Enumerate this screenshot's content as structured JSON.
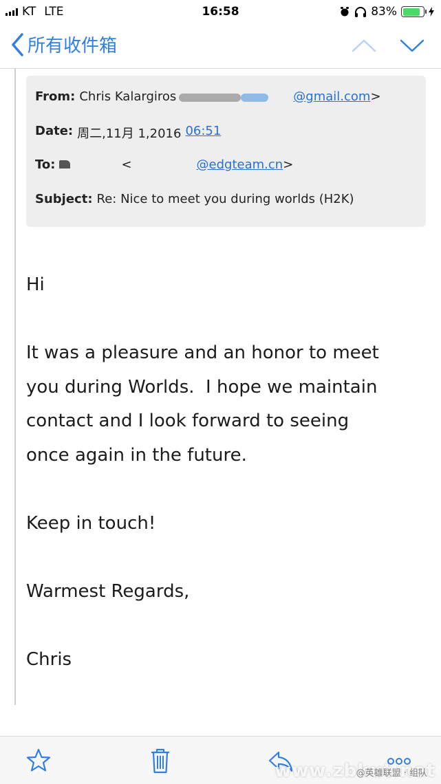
{
  "status_bar": {
    "carrier": "KT",
    "network": "LTE",
    "time": "16:58",
    "battery_percent": "83%",
    "battery_level": 0.83,
    "battery_color": "#4cd964"
  },
  "nav": {
    "back_label": "所有收件箱",
    "accent_color": "#2f7fe3",
    "up_icon": "chevron-up-icon",
    "down_icon": "chevron-down-icon"
  },
  "email": {
    "from_label": "From:",
    "from_name": "Chris Kalargiros",
    "from_email_visible": "@gmail.com",
    "from_email_suffix": ">",
    "date_label": "Date:",
    "date_value": "周二,11月 1,2016",
    "date_time": "06:51",
    "to_label": "To:",
    "to_open": "<",
    "to_email_visible": "@edgteam.cn",
    "to_close": ">",
    "subject_label": "Subject:",
    "subject_value": "Re: Nice to meet you during worlds (H2K)",
    "body": {
      "greeting": "Hi",
      "paragraph1": "It was a pleasure and an honor to meet\nyou during Worlds.  I hope we maintain\ncontact and I look forward to seeing\nonce again in the future.",
      "paragraph2": "Keep in touch!",
      "closing": "Warmest Regards,",
      "signature": "Chris"
    }
  },
  "toolbar": {
    "icons": [
      "star-icon",
      "trash-icon",
      "reply-icon",
      "more-icon"
    ]
  },
  "watermark": {
    "text": "www.zbkut.net",
    "credit": "@英雄联盟 · 组队"
  }
}
